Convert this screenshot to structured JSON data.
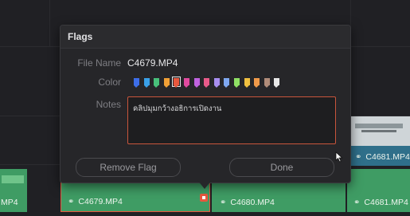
{
  "dialog": {
    "title": "Flags",
    "file_name_label": "File Name",
    "file_name_value": "C4679.MP4",
    "color_label": "Color",
    "notes_label": "Notes",
    "notes_value": "คลิปมุมกว้างอธิการเปิดงาน",
    "remove_flag_label": "Remove Flag",
    "done_label": "Done",
    "flag_colors": [
      "#3d6ee8",
      "#3aa0e8",
      "#48c07a",
      "#f0a036",
      "#e8583e",
      "#e14aa0",
      "#c062e0",
      "#e85a8a",
      "#a88ef0",
      "#7fa8f0",
      "#8fe064",
      "#f0c040",
      "#f09a4a",
      "#b08c7a",
      "#e8e8e8"
    ],
    "selected_flag_color": "#e8583e"
  },
  "timeline": {
    "clips": [
      {
        "label": "MP4"
      },
      {
        "label": "C4679.MP4"
      },
      {
        "label": "C4680.MP4"
      },
      {
        "label": "C4681.MP4"
      },
      {
        "label": "C4681.MP4"
      }
    ],
    "marker_color": "#e8583e",
    "clip_color": "#3f9c64"
  }
}
